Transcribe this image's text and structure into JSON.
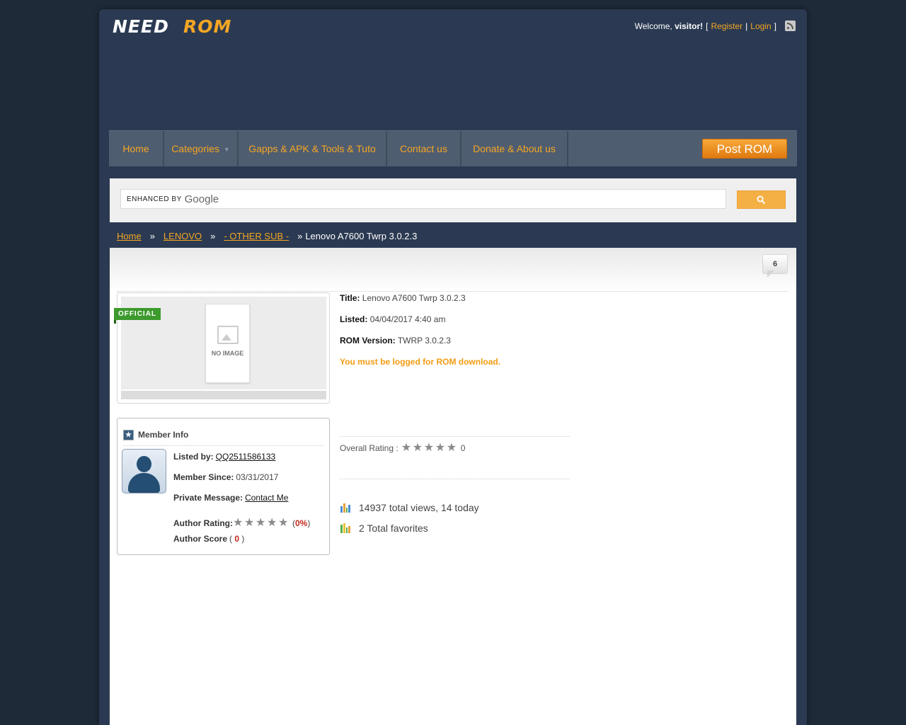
{
  "header": {
    "logo_text": "NEEDROM",
    "welcome_prefix": "Welcome,",
    "welcome_user": "visitor!",
    "bracket_open": "[",
    "register": "Register",
    "sep": "|",
    "login": "Login",
    "bracket_close": "]"
  },
  "nav": {
    "items": [
      {
        "label": "Home"
      },
      {
        "label": "Categories"
      },
      {
        "label": "Gapps & APK & Tools & Tuto"
      },
      {
        "label": "Contact us"
      },
      {
        "label": "Donate & About us"
      }
    ],
    "post_rom": "Post ROM"
  },
  "search": {
    "enhanced_by": "ENHANCED BY",
    "google": "Google"
  },
  "breadcrumb": {
    "home": "Home",
    "sep": "»",
    "brand": "LENOVO",
    "sub": "- OTHER SUB -",
    "current": "Lenovo A7600 Twrp 3.0.2.3"
  },
  "listing": {
    "comment_count": "6",
    "badge": "OFFICIAL",
    "no_image": "NO IMAGE",
    "title_label": "Title:",
    "title": "Lenovo A7600 Twrp 3.0.2.3",
    "listed_label": "Listed:",
    "listed": "04/04/2017 4:40 am",
    "version_label": "ROM Version:",
    "version": "TWRP 3.0.2.3",
    "login_notice": "You must be logged for ROM download."
  },
  "member": {
    "title": "Member Info",
    "listed_by_label": "Listed by:",
    "listed_by": "QQ2511586133",
    "since_label": "Member Since:",
    "since": "03/31/2017",
    "pm_label": "Private Message:",
    "pm_link": "Contact Me",
    "rating_label": "Author Rating:",
    "rating_open": "(",
    "rating_pct": "0%",
    "rating_close": ")",
    "score_label": "Author Score",
    "score_open": "(",
    "score": "0",
    "score_close": ")",
    "author_rating_value": 0
  },
  "rating": {
    "label": "Overall Rating :",
    "value": "0",
    "stars_filled": 0
  },
  "stats": {
    "views": "14937 total views, 14 today",
    "favorites": "2 Total favorites"
  },
  "colors": {
    "accent": "#f5a623",
    "nav_bg": "#4f5d70",
    "page_bg": "#1f2a38",
    "panel_bg": "#2b3a52",
    "official": "#3d9a2d"
  }
}
